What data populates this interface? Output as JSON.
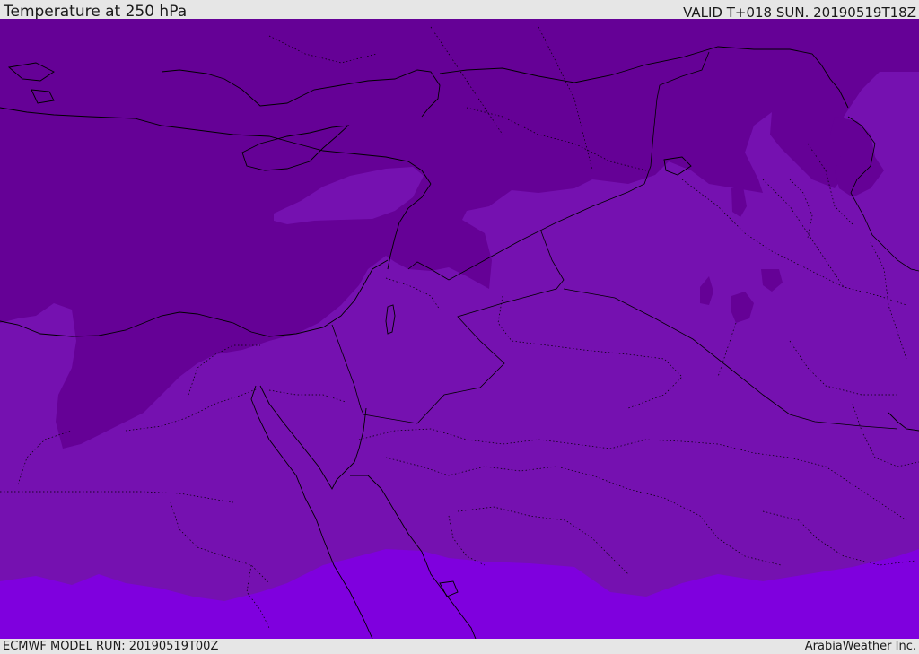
{
  "header": {
    "title": "Temperature at 250 hPa",
    "valid": "VALID T+018 SUN. 20190519T18Z"
  },
  "footer": {
    "model_run": "ECMWF MODEL RUN: 20190519T00Z",
    "credit": "ArabiaWeather Inc."
  },
  "map": {
    "fill_colors": {
      "cold_band": "#650196",
      "mid_band": "#7511b0",
      "warm_band": "#7f00de"
    },
    "line_color": "#000000"
  }
}
